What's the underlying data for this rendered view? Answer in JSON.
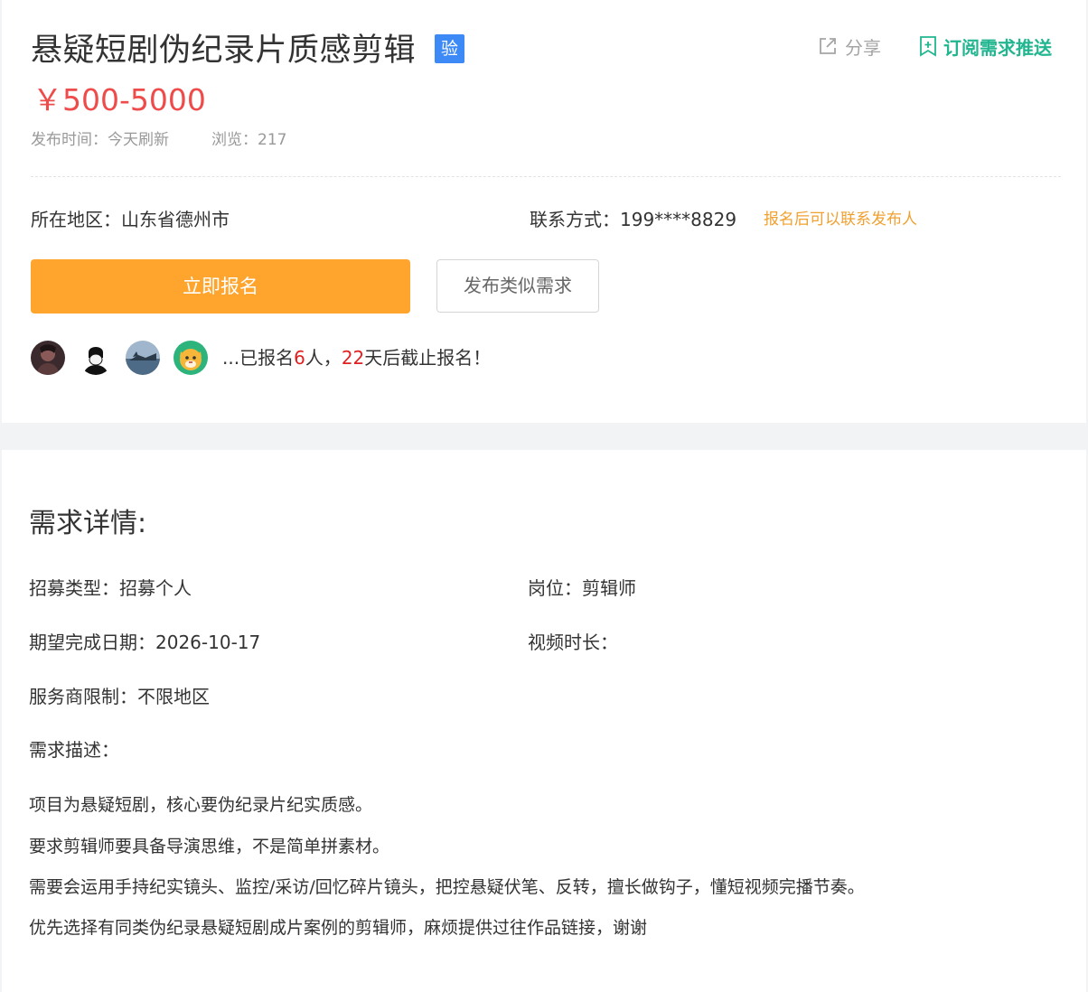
{
  "header": {
    "title": "悬疑短剧伪纪录片质感剪辑",
    "verify_badge": "验",
    "share_label": "分享",
    "subscribe_label": "订阅需求推送",
    "price": "￥500-5000",
    "publish_time": "发布时间：今天刷新",
    "views": "浏览：217"
  },
  "info": {
    "region": "所在地区：山东省德州市",
    "contact": "联系方式：199****8829",
    "contact_tip": "报名后可以联系发布人"
  },
  "actions": {
    "signup_label": "立即报名",
    "publish_similar_label": "发布类似需求"
  },
  "signup": {
    "prefix": "...已报名",
    "count": "6",
    "mid": "人，",
    "days": "22",
    "suffix": "天后截止报名！"
  },
  "details": {
    "section_title": "需求详情:",
    "recruit_type": "招募类型：招募个人",
    "position": "岗位：剪辑师",
    "expected_date": "期望完成日期：2026-10-17",
    "video_duration": "视频时长：",
    "provider_limit": "服务商限制：不限地区",
    "desc_label": "需求描述：",
    "description": [
      "项目为悬疑短剧，核心要伪纪录片纪实质感。",
      "要求剪辑师要具备导演思维，不是简单拼素材。",
      "需要会运用手持纪实镜头、监控/采访/回忆碎片镜头，把控悬疑伏笔、反转，擅长做钩子，懂短视频完播节奏。",
      "优先选择有同类伪纪录悬疑短剧成片案例的剪辑师，麻烦提供过往作品链接，谢谢"
    ]
  },
  "colors": {
    "price": "#ee4b4b",
    "primary_button": "#ffa42c",
    "subscribe": "#21b68f",
    "verify_badge": "#3d8af7",
    "contact_tip": "#f0a030",
    "highlight": "#e02020"
  },
  "icons": {
    "share": "share-icon",
    "subscribe": "bookmark-plus-icon"
  }
}
